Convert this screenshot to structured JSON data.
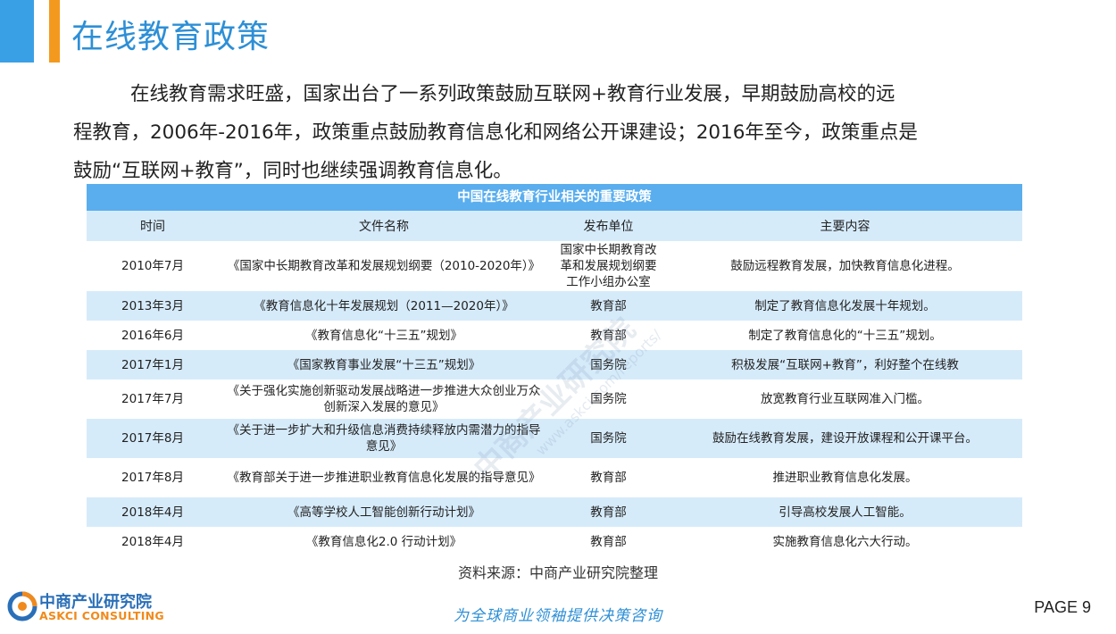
{
  "header": {
    "title": "在线教育政策"
  },
  "intro": {
    "lines": [
      "在线教育需求旺盛，国家出台了一系列政策鼓励互联网+教育行业发展，早期鼓励高校的远",
      "程教育，2006年-2016年，政策重点鼓励教育信息化和网络公开课建设；2016年至今，政策重点是",
      "鼓励“互联网+教育”，同时也继续强调教育信息化。"
    ]
  },
  "table": {
    "caption": "中国在线教育行业相关的重要政策",
    "headers": [
      "时间",
      "文件名称",
      "发布单位",
      "主要内容"
    ],
    "rows": [
      [
        "2010年7月",
        "《国家中长期教育改革和发展规划纲要（2010-2020年）》",
        "国家中长期教育改革和发展规划纲要工作小组办公室",
        "鼓励远程教育发展，加快教育信息化进程。"
      ],
      [
        "2013年3月",
        "《教育信息化十年发展规划（2011—2020年）》",
        "教育部",
        "制定了教育信息化发展十年规划。"
      ],
      [
        "2016年6月",
        "《教育信息化“十三五”规划》",
        "教育部",
        "制定了教育信息化的“十三五”规划。"
      ],
      [
        "2017年1月",
        "《国家教育事业发展“十三五”规划》",
        "国务院",
        "积极发展“互联网+教育”，利好整个在线教"
      ],
      [
        "2017年7月",
        "《关于强化实施创新驱动发展战略进一步推进大众创业万众创新深入发展的意见》",
        "国务院",
        "放宽教育行业互联网准入门槛。"
      ],
      [
        "2017年8月",
        "《关于进一步扩大和升级信息消费持续释放内需潜力的指导意见》",
        "国务院",
        "鼓励在线教育发展，建设开放课程和公开课平台。"
      ],
      [
        "2017年8月",
        "《教育部关于进一步推进职业教育信息化发展的指导意见》",
        "教育部",
        "推进职业教育信息化发展。"
      ],
      [
        "2018年4月",
        "《高等学校人工智能创新行动计划》",
        "教育部",
        "引导高校发展人工智能。"
      ],
      [
        "2018年4月",
        "《教育信息化2.0 行动计划》",
        "教育部",
        "实施教育信息化六大行动。"
      ]
    ]
  },
  "source": "资料来源：中商产业研究院整理",
  "watermark": {
    "text": "中商产业研究院",
    "url": "www.askci.com/reports/"
  },
  "footer": {
    "logo_cn": "中商产业研究院",
    "logo_en": "ASKCI CONSULTING",
    "slogan": "为全球商业领袖提供决策咨询",
    "page": "PAGE  9"
  },
  "colors": {
    "accent_blue": "#3aa0e6",
    "accent_orange": "#f39a1e",
    "title_blue": "#2d8fd6",
    "table_header": "#5aaeee",
    "row_alt": "#d6ebfa"
  },
  "icons": {
    "logo": "askci-logo-icon"
  }
}
